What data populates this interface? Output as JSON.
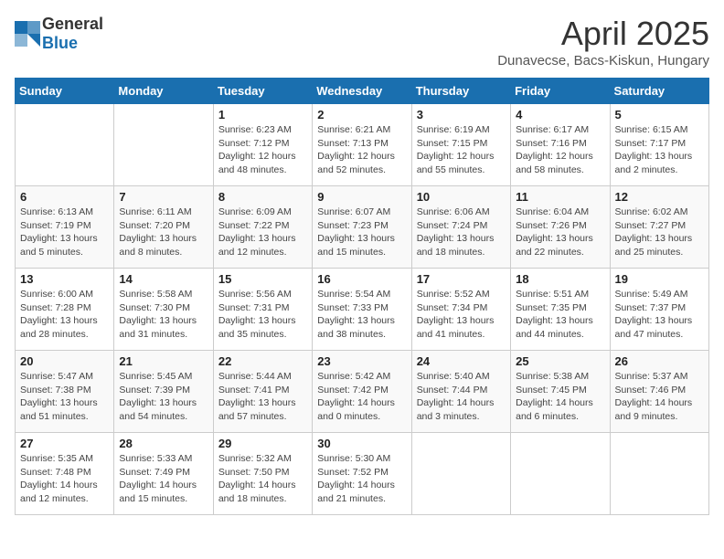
{
  "header": {
    "logo_general": "General",
    "logo_blue": "Blue",
    "title": "April 2025",
    "subtitle": "Dunavecse, Bacs-Kiskun, Hungary"
  },
  "weekdays": [
    "Sunday",
    "Monday",
    "Tuesday",
    "Wednesday",
    "Thursday",
    "Friday",
    "Saturday"
  ],
  "weeks": [
    [
      {
        "day": "",
        "info": ""
      },
      {
        "day": "",
        "info": ""
      },
      {
        "day": "1",
        "info": "Sunrise: 6:23 AM\nSunset: 7:12 PM\nDaylight: 12 hours\nand 48 minutes."
      },
      {
        "day": "2",
        "info": "Sunrise: 6:21 AM\nSunset: 7:13 PM\nDaylight: 12 hours\nand 52 minutes."
      },
      {
        "day": "3",
        "info": "Sunrise: 6:19 AM\nSunset: 7:15 PM\nDaylight: 12 hours\nand 55 minutes."
      },
      {
        "day": "4",
        "info": "Sunrise: 6:17 AM\nSunset: 7:16 PM\nDaylight: 12 hours\nand 58 minutes."
      },
      {
        "day": "5",
        "info": "Sunrise: 6:15 AM\nSunset: 7:17 PM\nDaylight: 13 hours\nand 2 minutes."
      }
    ],
    [
      {
        "day": "6",
        "info": "Sunrise: 6:13 AM\nSunset: 7:19 PM\nDaylight: 13 hours\nand 5 minutes."
      },
      {
        "day": "7",
        "info": "Sunrise: 6:11 AM\nSunset: 7:20 PM\nDaylight: 13 hours\nand 8 minutes."
      },
      {
        "day": "8",
        "info": "Sunrise: 6:09 AM\nSunset: 7:22 PM\nDaylight: 13 hours\nand 12 minutes."
      },
      {
        "day": "9",
        "info": "Sunrise: 6:07 AM\nSunset: 7:23 PM\nDaylight: 13 hours\nand 15 minutes."
      },
      {
        "day": "10",
        "info": "Sunrise: 6:06 AM\nSunset: 7:24 PM\nDaylight: 13 hours\nand 18 minutes."
      },
      {
        "day": "11",
        "info": "Sunrise: 6:04 AM\nSunset: 7:26 PM\nDaylight: 13 hours\nand 22 minutes."
      },
      {
        "day": "12",
        "info": "Sunrise: 6:02 AM\nSunset: 7:27 PM\nDaylight: 13 hours\nand 25 minutes."
      }
    ],
    [
      {
        "day": "13",
        "info": "Sunrise: 6:00 AM\nSunset: 7:28 PM\nDaylight: 13 hours\nand 28 minutes."
      },
      {
        "day": "14",
        "info": "Sunrise: 5:58 AM\nSunset: 7:30 PM\nDaylight: 13 hours\nand 31 minutes."
      },
      {
        "day": "15",
        "info": "Sunrise: 5:56 AM\nSunset: 7:31 PM\nDaylight: 13 hours\nand 35 minutes."
      },
      {
        "day": "16",
        "info": "Sunrise: 5:54 AM\nSunset: 7:33 PM\nDaylight: 13 hours\nand 38 minutes."
      },
      {
        "day": "17",
        "info": "Sunrise: 5:52 AM\nSunset: 7:34 PM\nDaylight: 13 hours\nand 41 minutes."
      },
      {
        "day": "18",
        "info": "Sunrise: 5:51 AM\nSunset: 7:35 PM\nDaylight: 13 hours\nand 44 minutes."
      },
      {
        "day": "19",
        "info": "Sunrise: 5:49 AM\nSunset: 7:37 PM\nDaylight: 13 hours\nand 47 minutes."
      }
    ],
    [
      {
        "day": "20",
        "info": "Sunrise: 5:47 AM\nSunset: 7:38 PM\nDaylight: 13 hours\nand 51 minutes."
      },
      {
        "day": "21",
        "info": "Sunrise: 5:45 AM\nSunset: 7:39 PM\nDaylight: 13 hours\nand 54 minutes."
      },
      {
        "day": "22",
        "info": "Sunrise: 5:44 AM\nSunset: 7:41 PM\nDaylight: 13 hours\nand 57 minutes."
      },
      {
        "day": "23",
        "info": "Sunrise: 5:42 AM\nSunset: 7:42 PM\nDaylight: 14 hours\nand 0 minutes."
      },
      {
        "day": "24",
        "info": "Sunrise: 5:40 AM\nSunset: 7:44 PM\nDaylight: 14 hours\nand 3 minutes."
      },
      {
        "day": "25",
        "info": "Sunrise: 5:38 AM\nSunset: 7:45 PM\nDaylight: 14 hours\nand 6 minutes."
      },
      {
        "day": "26",
        "info": "Sunrise: 5:37 AM\nSunset: 7:46 PM\nDaylight: 14 hours\nand 9 minutes."
      }
    ],
    [
      {
        "day": "27",
        "info": "Sunrise: 5:35 AM\nSunset: 7:48 PM\nDaylight: 14 hours\nand 12 minutes."
      },
      {
        "day": "28",
        "info": "Sunrise: 5:33 AM\nSunset: 7:49 PM\nDaylight: 14 hours\nand 15 minutes."
      },
      {
        "day": "29",
        "info": "Sunrise: 5:32 AM\nSunset: 7:50 PM\nDaylight: 14 hours\nand 18 minutes."
      },
      {
        "day": "30",
        "info": "Sunrise: 5:30 AM\nSunset: 7:52 PM\nDaylight: 14 hours\nand 21 minutes."
      },
      {
        "day": "",
        "info": ""
      },
      {
        "day": "",
        "info": ""
      },
      {
        "day": "",
        "info": ""
      }
    ]
  ]
}
